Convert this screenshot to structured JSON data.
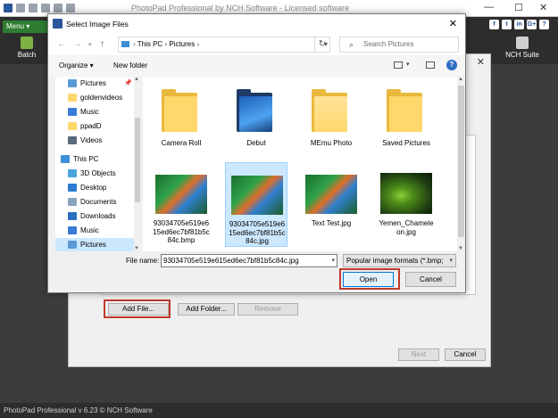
{
  "app": {
    "title": "PhotoPad Professional by NCH Software - Licensed software",
    "menu_label": "Menu ▾",
    "batch_label": "Batch",
    "nch_suite_label": "NCH Suite",
    "status": "PhotoPad Professional v 6.23 © NCH Software",
    "social": [
      "f",
      "t",
      "in",
      "G+",
      "?"
    ]
  },
  "batch_dialog": {
    "add_file": "Add File...",
    "add_folder": "Add Folder...",
    "remove": "Remove",
    "next": "Next",
    "cancel": "Cancel"
  },
  "file_dialog": {
    "title": "Select Image Files",
    "address": [
      "This PC",
      "Pictures"
    ],
    "search_placeholder": "Search Pictures",
    "organize": "Organize ▾",
    "new_folder": "New folder",
    "nav_items": [
      {
        "label": "Pictures",
        "icon": "pictures-icon",
        "pinned": true
      },
      {
        "label": "goldenvideos",
        "icon": "folder-icon"
      },
      {
        "label": "Music",
        "icon": "music-icon"
      },
      {
        "label": "ppadD",
        "icon": "folder-icon"
      },
      {
        "label": "Videos",
        "icon": "videos-icon"
      },
      {
        "label": "This PC",
        "icon": "computer-icon"
      },
      {
        "label": "3D Objects",
        "icon": "3d-objects-icon"
      },
      {
        "label": "Desktop",
        "icon": "desktop-icon"
      },
      {
        "label": "Documents",
        "icon": "documents-icon"
      },
      {
        "label": "Downloads",
        "icon": "downloads-icon"
      },
      {
        "label": "Music",
        "icon": "music-icon"
      },
      {
        "label": "Pictures",
        "icon": "pictures-icon",
        "selected": true
      }
    ],
    "files": [
      {
        "name": "Camera Roll",
        "kind": "folder"
      },
      {
        "name": "Debut",
        "kind": "folder"
      },
      {
        "name": "MEmu Photo",
        "kind": "folder"
      },
      {
        "name": "Saved Pictures",
        "kind": "folder"
      },
      {
        "name": "93034705e519e615ed6ec7bf81b5c84c.bmp",
        "kind": "image"
      },
      {
        "name": "93034705e519e615ed6ec7bf81b5c84c.jpg",
        "kind": "image",
        "selected": true
      },
      {
        "name": "Text Test.jpg",
        "kind": "image"
      },
      {
        "name": "Yemen_Chameleon.jpg",
        "kind": "image"
      }
    ],
    "file_name_label": "File name:",
    "file_name_value": "93034705e519e615ed6ec7bf81b5c84c.jpg",
    "filter_value": "Popular image formats (*.bmp;",
    "open_label": "Open",
    "cancel_label": "Cancel"
  },
  "colors": {
    "highlight_box": "#c0392b",
    "selection": "#cce8ff",
    "accent": "#0078d7"
  }
}
